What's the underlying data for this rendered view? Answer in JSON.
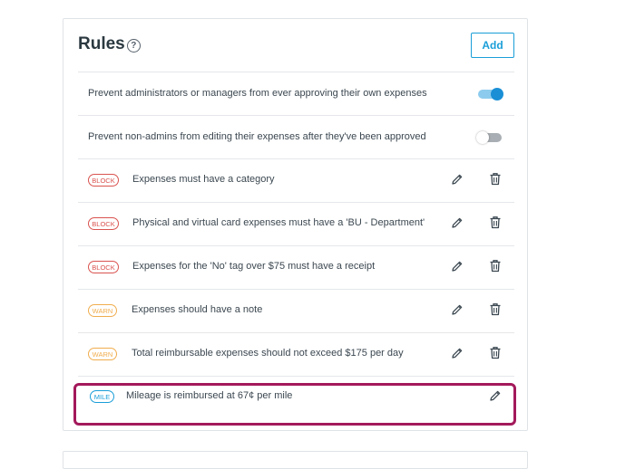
{
  "header": {
    "title": "Rules",
    "help_icon": "question-circle-icon",
    "add_label": "Add"
  },
  "toggles": [
    {
      "label": "Prevent administrators or managers from ever approving their own expenses",
      "state": "on"
    },
    {
      "label": "Prevent non-admins from editing their expenses after they've been approved",
      "state": "off"
    }
  ],
  "rules": [
    {
      "badge": "BLOCK",
      "text": "Expenses must have a category"
    },
    {
      "badge": "BLOCK",
      "text": "Physical and virtual card expenses must have a 'BU - Department'"
    },
    {
      "badge": "BLOCK",
      "text": "Expenses for the 'No' tag over $75 must have a receipt"
    },
    {
      "badge": "WARN",
      "text": "Expenses should have a note"
    },
    {
      "badge": "WARN",
      "text": "Total reimbursable expenses should not exceed $175 per day"
    },
    {
      "badge": "MILE",
      "text": "Mileage is reimbursed at 67¢ per mile"
    }
  ],
  "colors": {
    "accent": "#1a9ed8",
    "block": "#d9534f",
    "warn": "#f0ad4e",
    "highlight": "#a3195b"
  }
}
